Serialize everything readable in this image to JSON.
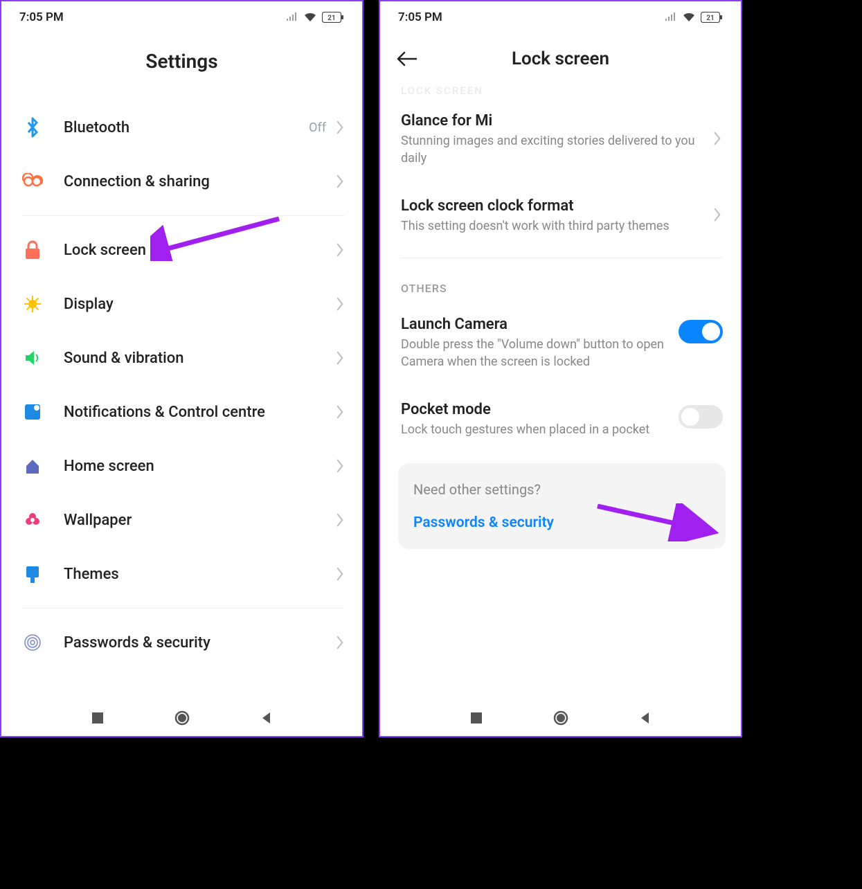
{
  "statusbar": {
    "time": "7:05 PM",
    "battery": "21"
  },
  "left": {
    "title": "Settings",
    "rows1": [
      {
        "label": "Bluetooth",
        "value": "Off",
        "icon": "bluetooth",
        "color": "#2196f3"
      },
      {
        "label": "Connection & sharing",
        "icon": "link",
        "color": "#ff7043"
      }
    ],
    "rows2": [
      {
        "label": "Lock screen",
        "icon": "lock",
        "color": "#ff6e59"
      },
      {
        "label": "Display",
        "icon": "sun",
        "color": "#ffc107"
      },
      {
        "label": "Sound & vibration",
        "icon": "speaker",
        "color": "#26d367"
      },
      {
        "label": "Notifications & Control centre",
        "icon": "notif",
        "color": "#1e88e5"
      },
      {
        "label": "Home screen",
        "icon": "home",
        "color": "#5c6bc0"
      },
      {
        "label": "Wallpaper",
        "icon": "flower",
        "color": "#ec407a"
      },
      {
        "label": "Themes",
        "icon": "theme",
        "color": "#1e88e5"
      }
    ],
    "rows3": [
      {
        "label": "Passwords & security",
        "icon": "fingerprint",
        "color": "#7986cb"
      }
    ]
  },
  "right": {
    "title": "Lock screen",
    "cut_header": "LOCK SCREEN",
    "items1": [
      {
        "title": "Glance for Mi",
        "desc": "Stunning images and exciting stories delivered to you daily",
        "type": "chevron"
      },
      {
        "title": "Lock screen clock format",
        "desc": "This setting doesn't work with third party themes",
        "type": "chevron"
      }
    ],
    "others_label": "OTHERS",
    "items2": [
      {
        "title": "Launch Camera",
        "desc": "Double press the \"Volume down\" button to open Camera when the screen is locked",
        "type": "toggle",
        "on": true
      },
      {
        "title": "Pocket mode",
        "desc": "Lock touch gestures when placed in a pocket",
        "type": "toggle",
        "on": false
      }
    ],
    "linkbox": {
      "title": "Need other settings?",
      "link": "Passwords & security"
    }
  }
}
